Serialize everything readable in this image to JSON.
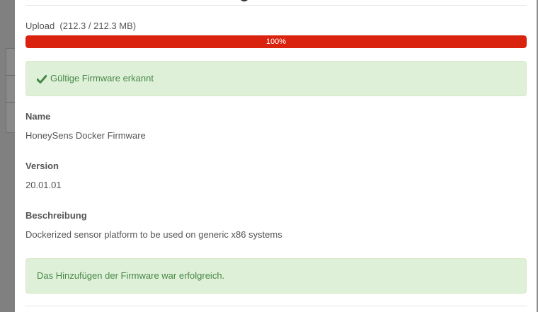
{
  "upload": {
    "label": "Upload  (212.3 / 212.3 MB)",
    "progress_percent": 100,
    "progress_text": "100%"
  },
  "validation": {
    "icon": "check-icon",
    "message": "Gültige Firmware erkannt"
  },
  "fields": {
    "name": {
      "label": "Name",
      "value": "HoneySens Docker Firmware"
    },
    "version": {
      "label": "Version",
      "value": "20.01.01"
    },
    "description": {
      "label": "Beschreibung",
      "value": "Dockerized sensor platform to be used on generic x86 systems"
    }
  },
  "result": {
    "message": "Das Hinzufügen der Firmware war erfolgreich."
  },
  "colors": {
    "progress": "#d9230f",
    "success_bg": "#dff0d8",
    "success_text": "#468847"
  }
}
